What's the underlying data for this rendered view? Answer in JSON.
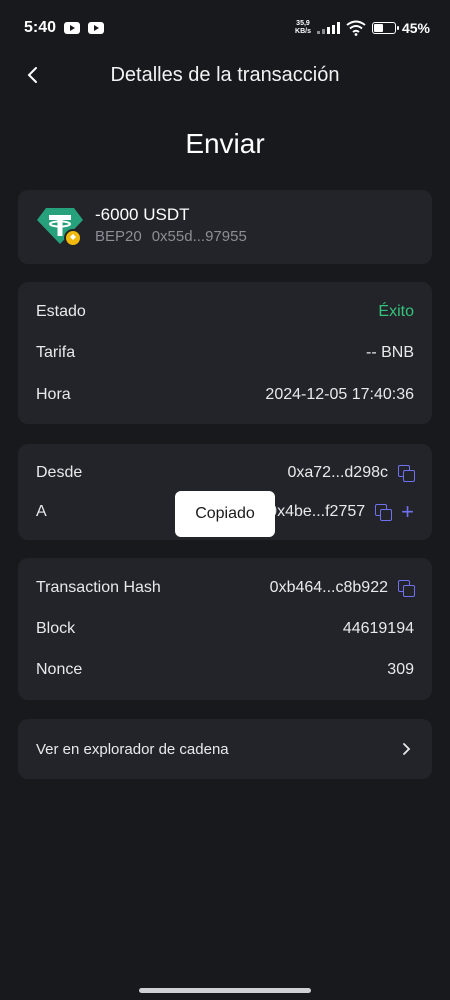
{
  "status_bar": {
    "time": "5:40",
    "net_speed_value": "35,9",
    "net_speed_unit": "KB/s",
    "battery_pct": "45%",
    "icons": [
      "youtube-icon",
      "youtube-icon",
      "signal-icon",
      "wifi-icon",
      "battery-icon"
    ]
  },
  "header": {
    "title": "Detalles de la transacción",
    "back_icon": "chevron-left-icon"
  },
  "main": {
    "type_title": "Enviar",
    "token": {
      "amount": "-6000 USDT",
      "network": "BEP20",
      "address": "0x55d...97955",
      "logo_icon": "tether-logo-icon",
      "badge_icon": "bnb-badge-icon"
    },
    "info": {
      "status_label": "Estado",
      "status_value": "Éxito",
      "fee_label": "Tarifa",
      "fee_value": "-- BNB",
      "time_label": "Hora",
      "time_value": "2024-12-05 17:40:36"
    },
    "addresses": {
      "from_label": "Desde",
      "from_value": "0xa72...d298c",
      "to_label": "A",
      "to_value": "0x4be...f2757"
    },
    "hash_info": {
      "hash_label": "Transaction Hash",
      "hash_value": "0xb464...c8b922",
      "block_label": "Block",
      "block_value": "44619194",
      "nonce_label": "Nonce",
      "nonce_value": "309"
    },
    "explorer": {
      "label": "Ver en explorador de cadena"
    }
  },
  "toast": {
    "text": "Copiado"
  },
  "colors": {
    "background": "#18191d",
    "card": "#232429",
    "accent": "#6f72f0",
    "success": "#35c27b"
  }
}
